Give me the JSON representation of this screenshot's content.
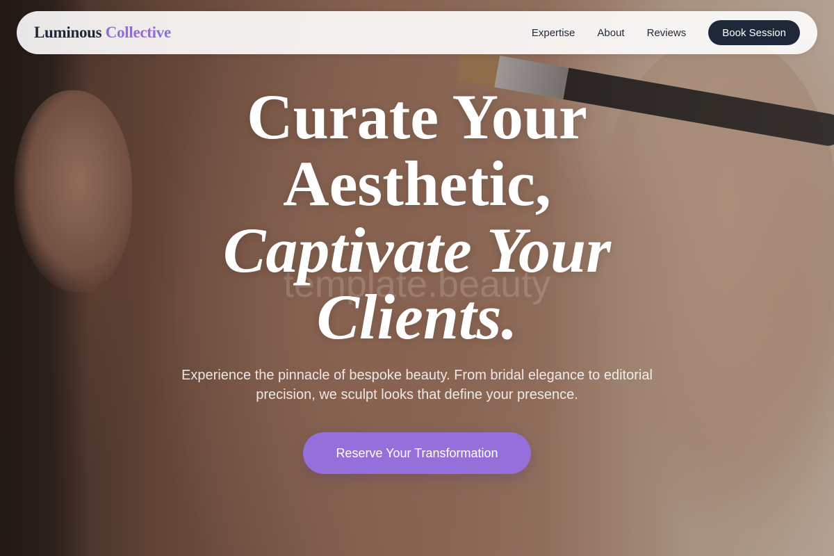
{
  "nav": {
    "logo_primary": "Luminous",
    "logo_accent": "Collective",
    "links": [
      "Expertise",
      "About",
      "Reviews"
    ],
    "cta_label": "Book Session"
  },
  "hero": {
    "headline_line1": "Curate Your",
    "headline_line2": "Aesthetic,",
    "headline_line3": "Captivate Your",
    "headline_line4": "Clients.",
    "watermark": "template.beauty",
    "subtext": "Experience the pinnacle of bespoke beauty. From bridal elegance to editorial precision, we sculpt looks that define your presence.",
    "cta_label": "Reserve Your Transformation"
  },
  "colors": {
    "brand_dark": "#1e2838",
    "brand_accent": "#8f6ed8",
    "cta_purple": "#9670da"
  }
}
